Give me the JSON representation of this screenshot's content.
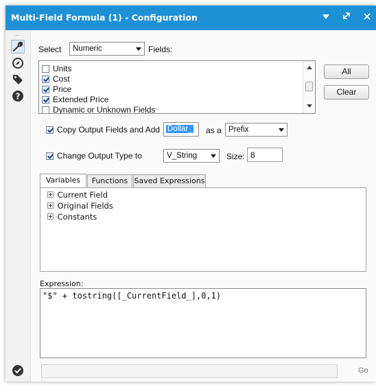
{
  "window": {
    "title": "Multi-Field Formula (1) - Configuration"
  },
  "sidebar": {
    "icons": [
      "wrench-icon",
      "compass-icon",
      "tag-icon",
      "help-icon"
    ],
    "more": "..."
  },
  "select_row": {
    "select_label": "Select",
    "type_value": "Numeric",
    "fields_label": "Fields:"
  },
  "fields_list": {
    "items": [
      {
        "label": "Units",
        "checked": false
      },
      {
        "label": "Cost",
        "checked": true
      },
      {
        "label": "Price",
        "checked": true
      },
      {
        "label": "Extended Price",
        "checked": true
      },
      {
        "label": "Dynamic or Unknown Fields",
        "checked": false
      }
    ]
  },
  "buttons": {
    "all": "All",
    "clear": "Clear",
    "go": "Go"
  },
  "copy_output": {
    "label": "Copy Output Fields and Add",
    "checked": true,
    "value": "Dollar_",
    "as_label": "as a",
    "position_value": "Prefix"
  },
  "change_type": {
    "label": "Change Output Type to",
    "checked": true,
    "type_value": "V_String",
    "size_label": "Size:",
    "size_value": "8"
  },
  "tabs": [
    "Variables",
    "Functions",
    "Saved Expressions"
  ],
  "tree": [
    "Current Field",
    "Original Fields",
    "Constants"
  ],
  "expression": {
    "label": "Expression:",
    "text": "\"$\" + tostring([_CurrentField_],0,1)"
  },
  "colors": {
    "titlebar": "#1e90d6",
    "selection": "#3399ff"
  }
}
